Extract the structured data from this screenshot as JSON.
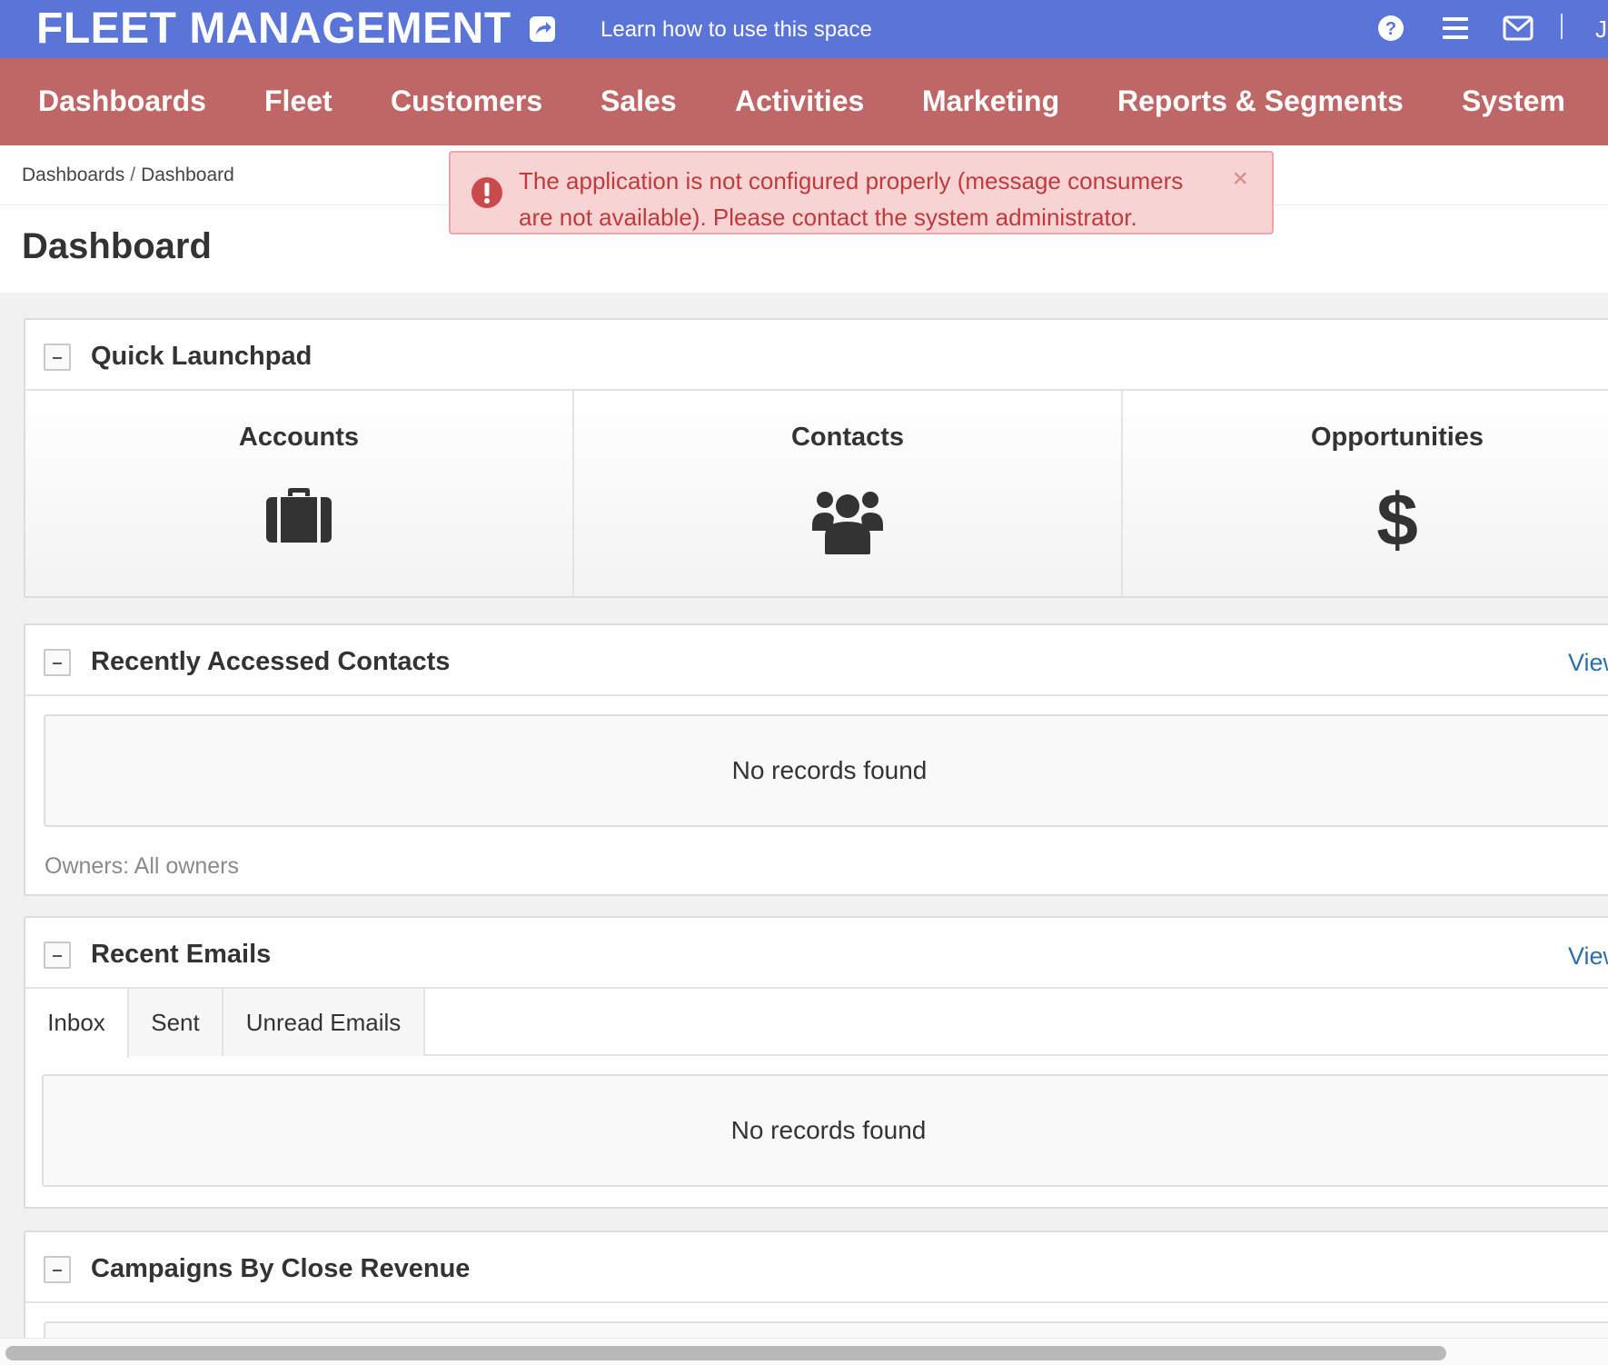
{
  "topbar": {
    "app_title": "FLEET MANAGEMENT",
    "learn_link": "Learn how to use this space",
    "user_initial": "J",
    "icons": [
      "external-link-icon",
      "help-icon",
      "menu-icon",
      "mail-icon"
    ],
    "background_color": "#5a74d8"
  },
  "main_nav": {
    "background_color": "#bf6766",
    "items": [
      {
        "label": "Dashboards"
      },
      {
        "label": "Fleet"
      },
      {
        "label": "Customers"
      },
      {
        "label": "Sales"
      },
      {
        "label": "Activities"
      },
      {
        "label": "Marketing"
      },
      {
        "label": "Reports & Segments"
      },
      {
        "label": "System"
      }
    ]
  },
  "breadcrumb": {
    "items": [
      "Dashboards",
      "Dashboard"
    ],
    "separator": "/"
  },
  "alert": {
    "message": "The application is not configured properly (message consumers are not available). Please contact the system administrator.",
    "close_label": "×",
    "icon": "exclamation-circle-icon",
    "color": "#c0393b"
  },
  "page": {
    "title": "Dashboard"
  },
  "widgets": {
    "quick_launchpad": {
      "title": "Quick Launchpad",
      "items": [
        {
          "label": "Accounts",
          "icon": "briefcase-icon"
        },
        {
          "label": "Contacts",
          "icon": "users-icon"
        },
        {
          "label": "Opportunities",
          "icon": "dollar-icon"
        }
      ]
    },
    "recent_contacts": {
      "title": "Recently Accessed Contacts",
      "view_link": "View",
      "empty_text": "No records found",
      "owners": "Owners: All owners"
    },
    "recent_emails": {
      "title": "Recent Emails",
      "view_link": "View",
      "tabs": [
        {
          "label": "Inbox",
          "active": true
        },
        {
          "label": "Sent",
          "active": false
        },
        {
          "label": "Unread Emails",
          "active": false
        }
      ],
      "empty_text": "No records found"
    },
    "campaigns": {
      "title": "Campaigns By Close Revenue"
    }
  }
}
